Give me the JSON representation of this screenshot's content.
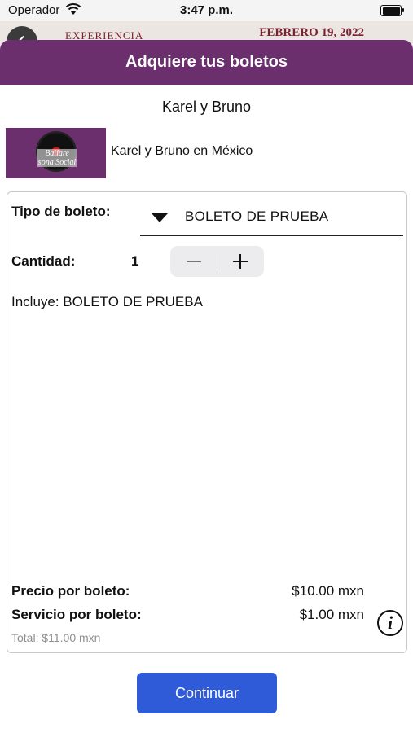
{
  "status_bar": {
    "carrier": "Operador",
    "time": "3:47 p.m.",
    "battery_level": 1.0
  },
  "background_page": {
    "left_text": "EXPERIENCIA",
    "date": "FEBRERO 19, 2022"
  },
  "sheet": {
    "title": "Adquiere tus boletos",
    "event_title": "Karel y Bruno",
    "event_name": "Karel y Bruno en México",
    "thumbnail_text": "Bailare sona Social"
  },
  "form": {
    "ticket_type_label": "Tipo de boleto:",
    "ticket_type_value": "BOLETO DE PRUEBA",
    "quantity_label": "Cantidad:",
    "quantity_value": "1",
    "includes_text": "Incluye: BOLETO DE PRUEBA"
  },
  "pricing": {
    "price_label": "Precio por boleto:",
    "price_value": "$10.00 mxn",
    "service_label": "Servicio por boleto:",
    "service_value": "$1.00 mxn",
    "total_text": "Total: $11.00 mxn"
  },
  "actions": {
    "continue_label": "Continuar"
  },
  "colors": {
    "header_purple": "#6b2f6e",
    "button_blue": "#2f5ad8",
    "total_gray": "#8e8e8e"
  }
}
